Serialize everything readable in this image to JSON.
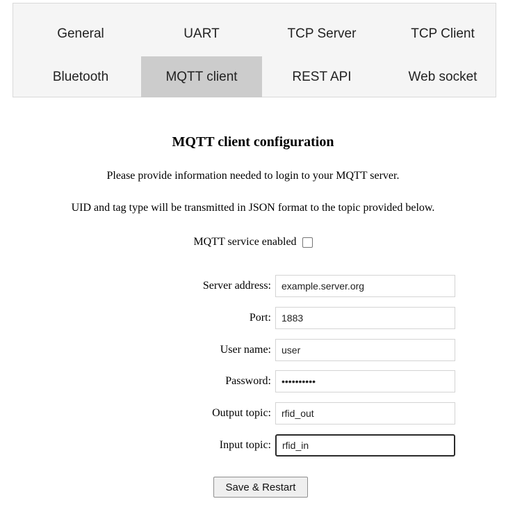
{
  "tabs": {
    "row1": [
      "General",
      "UART",
      "TCP Server",
      "TCP Client"
    ],
    "row2": [
      "Bluetooth",
      "MQTT client",
      "REST API",
      "Web socket"
    ],
    "active": "MQTT client"
  },
  "page": {
    "heading": "MQTT client configuration",
    "intro1": "Please provide information needed to login to your MQTT server.",
    "intro2": "UID and tag type will be transmitted in JSON format to the topic provided below.",
    "enabled_label": "MQTT service enabled",
    "enabled_checked": false
  },
  "form": {
    "server": {
      "label": "Server address:",
      "value": "example.server.org"
    },
    "port": {
      "label": "Port:",
      "value": "1883"
    },
    "user": {
      "label": "User name:",
      "value": "user"
    },
    "password": {
      "label": "Password:",
      "value": "••••••••••"
    },
    "output_topic": {
      "label": "Output topic:",
      "value": "rfid_out"
    },
    "input_topic": {
      "label": "Input topic:",
      "value": "rfid_in"
    }
  },
  "actions": {
    "save_label": "Save & Restart"
  }
}
